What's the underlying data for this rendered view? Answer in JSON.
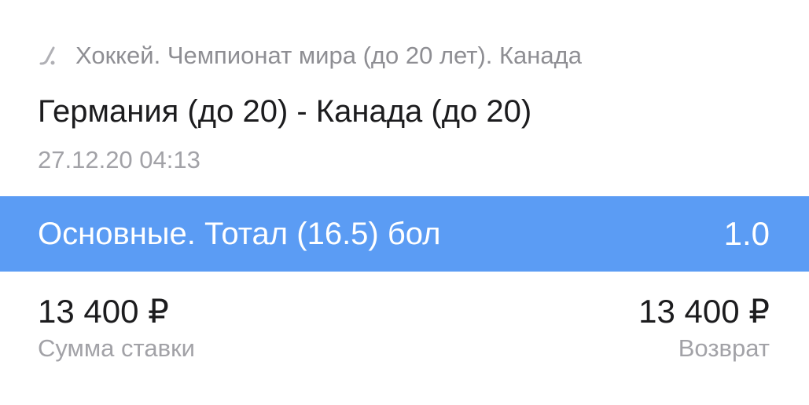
{
  "header": {
    "league_icon": "hockey-stick-icon",
    "league": "Хоккей. Чемпионат мира (до 20 лет). Канада",
    "match": "Германия (до 20) - Канада (до 20)",
    "datetime": "27.12.20 04:13"
  },
  "bet": {
    "outcome": "Основные. Тотал (16.5) бол",
    "coefficient": "1.0",
    "bar_color": "#5b9cf4"
  },
  "stake": {
    "amount": "13 400 ₽",
    "label": "Сумма ставки"
  },
  "refund": {
    "amount": "13 400 ₽",
    "label": "Возврат"
  }
}
